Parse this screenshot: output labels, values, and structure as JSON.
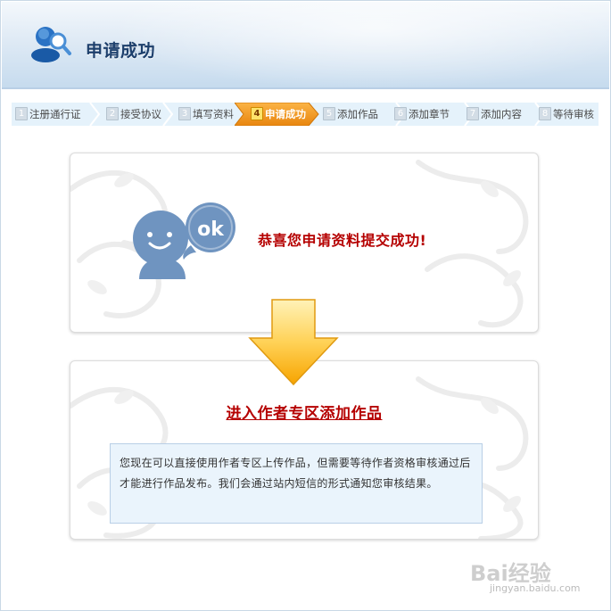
{
  "header": {
    "title": "申请成功",
    "icon": "user-search-icon"
  },
  "steps": [
    {
      "num": "1",
      "label": "注册通行证",
      "active": false
    },
    {
      "num": "2",
      "label": "接受协议",
      "active": false
    },
    {
      "num": "3",
      "label": "填写资料",
      "active": false
    },
    {
      "num": "4",
      "label": "申请成功",
      "active": true
    },
    {
      "num": "5",
      "label": "添加作品",
      "active": false
    },
    {
      "num": "6",
      "label": "添加章节",
      "active": false
    },
    {
      "num": "7",
      "label": "添加内容",
      "active": false
    },
    {
      "num": "8",
      "label": "等待审核",
      "active": false
    }
  ],
  "success_card": {
    "mascot_icon": "ok-speech-bubble-icon",
    "mascot_text": "ok",
    "message": "恭喜您申请资料提交成功!"
  },
  "arrow_icon": "down-arrow-icon",
  "next_card": {
    "link_text": "进入作者专区添加作品",
    "notice": "您现在可以直接使用作者专区上传作品，但需要等待作者资格审核通过后才能进行作品发布。我们会通过站内短信的形式通知您审核结果。"
  },
  "watermark": {
    "logo_text": "Bai经验",
    "url_text": "jingyan.baidu.com"
  },
  "colors": {
    "accent_red": "#b50000",
    "active_step": "#f39a1f",
    "header_blue": "#1d3f6c",
    "notice_bg": "#eaf4fc"
  }
}
